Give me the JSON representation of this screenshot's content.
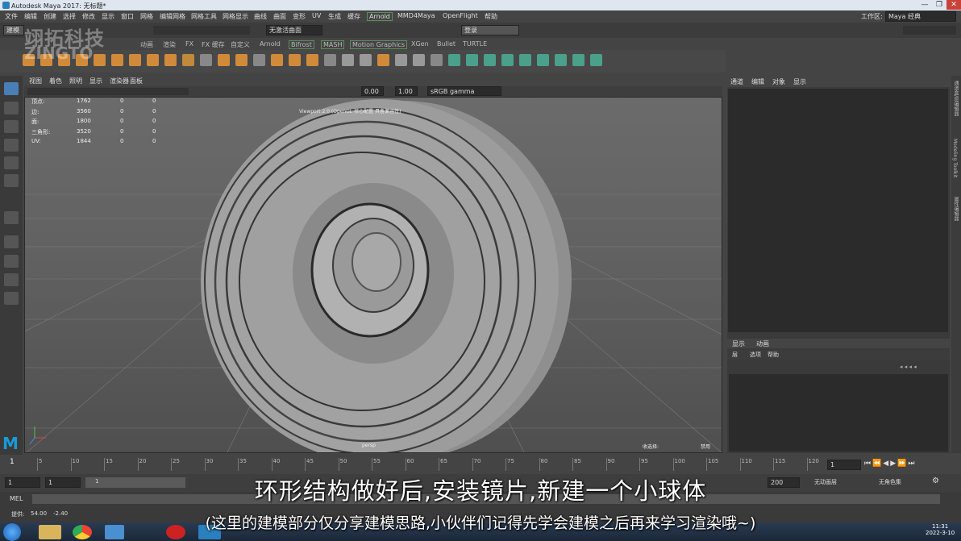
{
  "window": {
    "title": "Autodesk Maya 2017: 无标题*"
  },
  "menu": [
    "文件",
    "编辑",
    "创建",
    "选择",
    "修改",
    "显示",
    "窗口",
    "网格",
    "编辑网格",
    "网格工具",
    "网格显示",
    "曲线",
    "曲面",
    "变形",
    "UV",
    "生成",
    "缓存",
    "Arnold",
    "MMD4Maya",
    "OpenFlight",
    "帮助"
  ],
  "workspace": {
    "label": "工作区:",
    "value": "Maya 经典"
  },
  "status": {
    "mode": "建模",
    "no_live": "无激活曲面",
    "login": "登录"
  },
  "shelf_tabs": [
    "动画",
    "渲染",
    "FX",
    "FX 缓存",
    "自定义",
    "Arnold",
    "Bifrost",
    "MASH",
    "Motion Graphics",
    "XGen",
    "Bullet",
    "TURTLE"
  ],
  "watermark": {
    "line1": "翊拓科技",
    "line2": "ZINGTO"
  },
  "viewport": {
    "menu": [
      "视图",
      "着色",
      "照明",
      "显示",
      "渲染器",
      "面板"
    ],
    "field1": "0.00",
    "field2": "1.00",
    "colorspace": "sRGB gamma",
    "banner": "Viewport 2.0 (OpenGL 核心配置 具备兼容性)",
    "camera": "persp",
    "lbl_left": "收选择:",
    "lbl_right": "禁用",
    "hud": [
      {
        "k": "顶点:",
        "a": "1762",
        "b": "0",
        "c": "0"
      },
      {
        "k": "边:",
        "a": "3560",
        "b": "0",
        "c": "0"
      },
      {
        "k": "面:",
        "a": "1800",
        "b": "0",
        "c": "0"
      },
      {
        "k": "三角形:",
        "a": "3520",
        "b": "0",
        "c": "0"
      },
      {
        "k": "UV:",
        "a": "1844",
        "b": "0",
        "c": "0"
      }
    ]
  },
  "outliner": {
    "menu": [
      "通道",
      "编辑",
      "对象",
      "显示"
    ]
  },
  "layers": {
    "tabs": [
      "显示",
      "动画"
    ],
    "menu": [
      "层",
      "选项",
      "帮助"
    ]
  },
  "side_tabs": [
    "通道盒/层编辑器",
    "Modeling Toolkit",
    "属性编辑器"
  ],
  "timeline": {
    "ticks": [
      "5",
      "10",
      "15",
      "20",
      "25",
      "30",
      "35",
      "40",
      "45",
      "50",
      "55",
      "60",
      "65",
      "70",
      "75",
      "80",
      "85",
      "90",
      "95",
      "100",
      "105",
      "110",
      "115",
      "120"
    ],
    "start": "1",
    "current": "1"
  },
  "range": {
    "start": "1",
    "start2": "1",
    "rstart": "1",
    "end": "200",
    "anim_layer": "无动画层",
    "char_set": "无角色集"
  },
  "mel": {
    "label": "MEL"
  },
  "help": {
    "text": "提供:",
    "x": "54.00",
    "y": "-2.40"
  },
  "subtitle": {
    "main": "环形结构做好后,安装镜片,新建一个小球体",
    "note": "(这里的建模部分仅分享建模思路,小伙伴们记得先学会建模之后再来学习渲染哦~)"
  },
  "clock": {
    "time": "11:31",
    "date": "2022-3-10"
  }
}
